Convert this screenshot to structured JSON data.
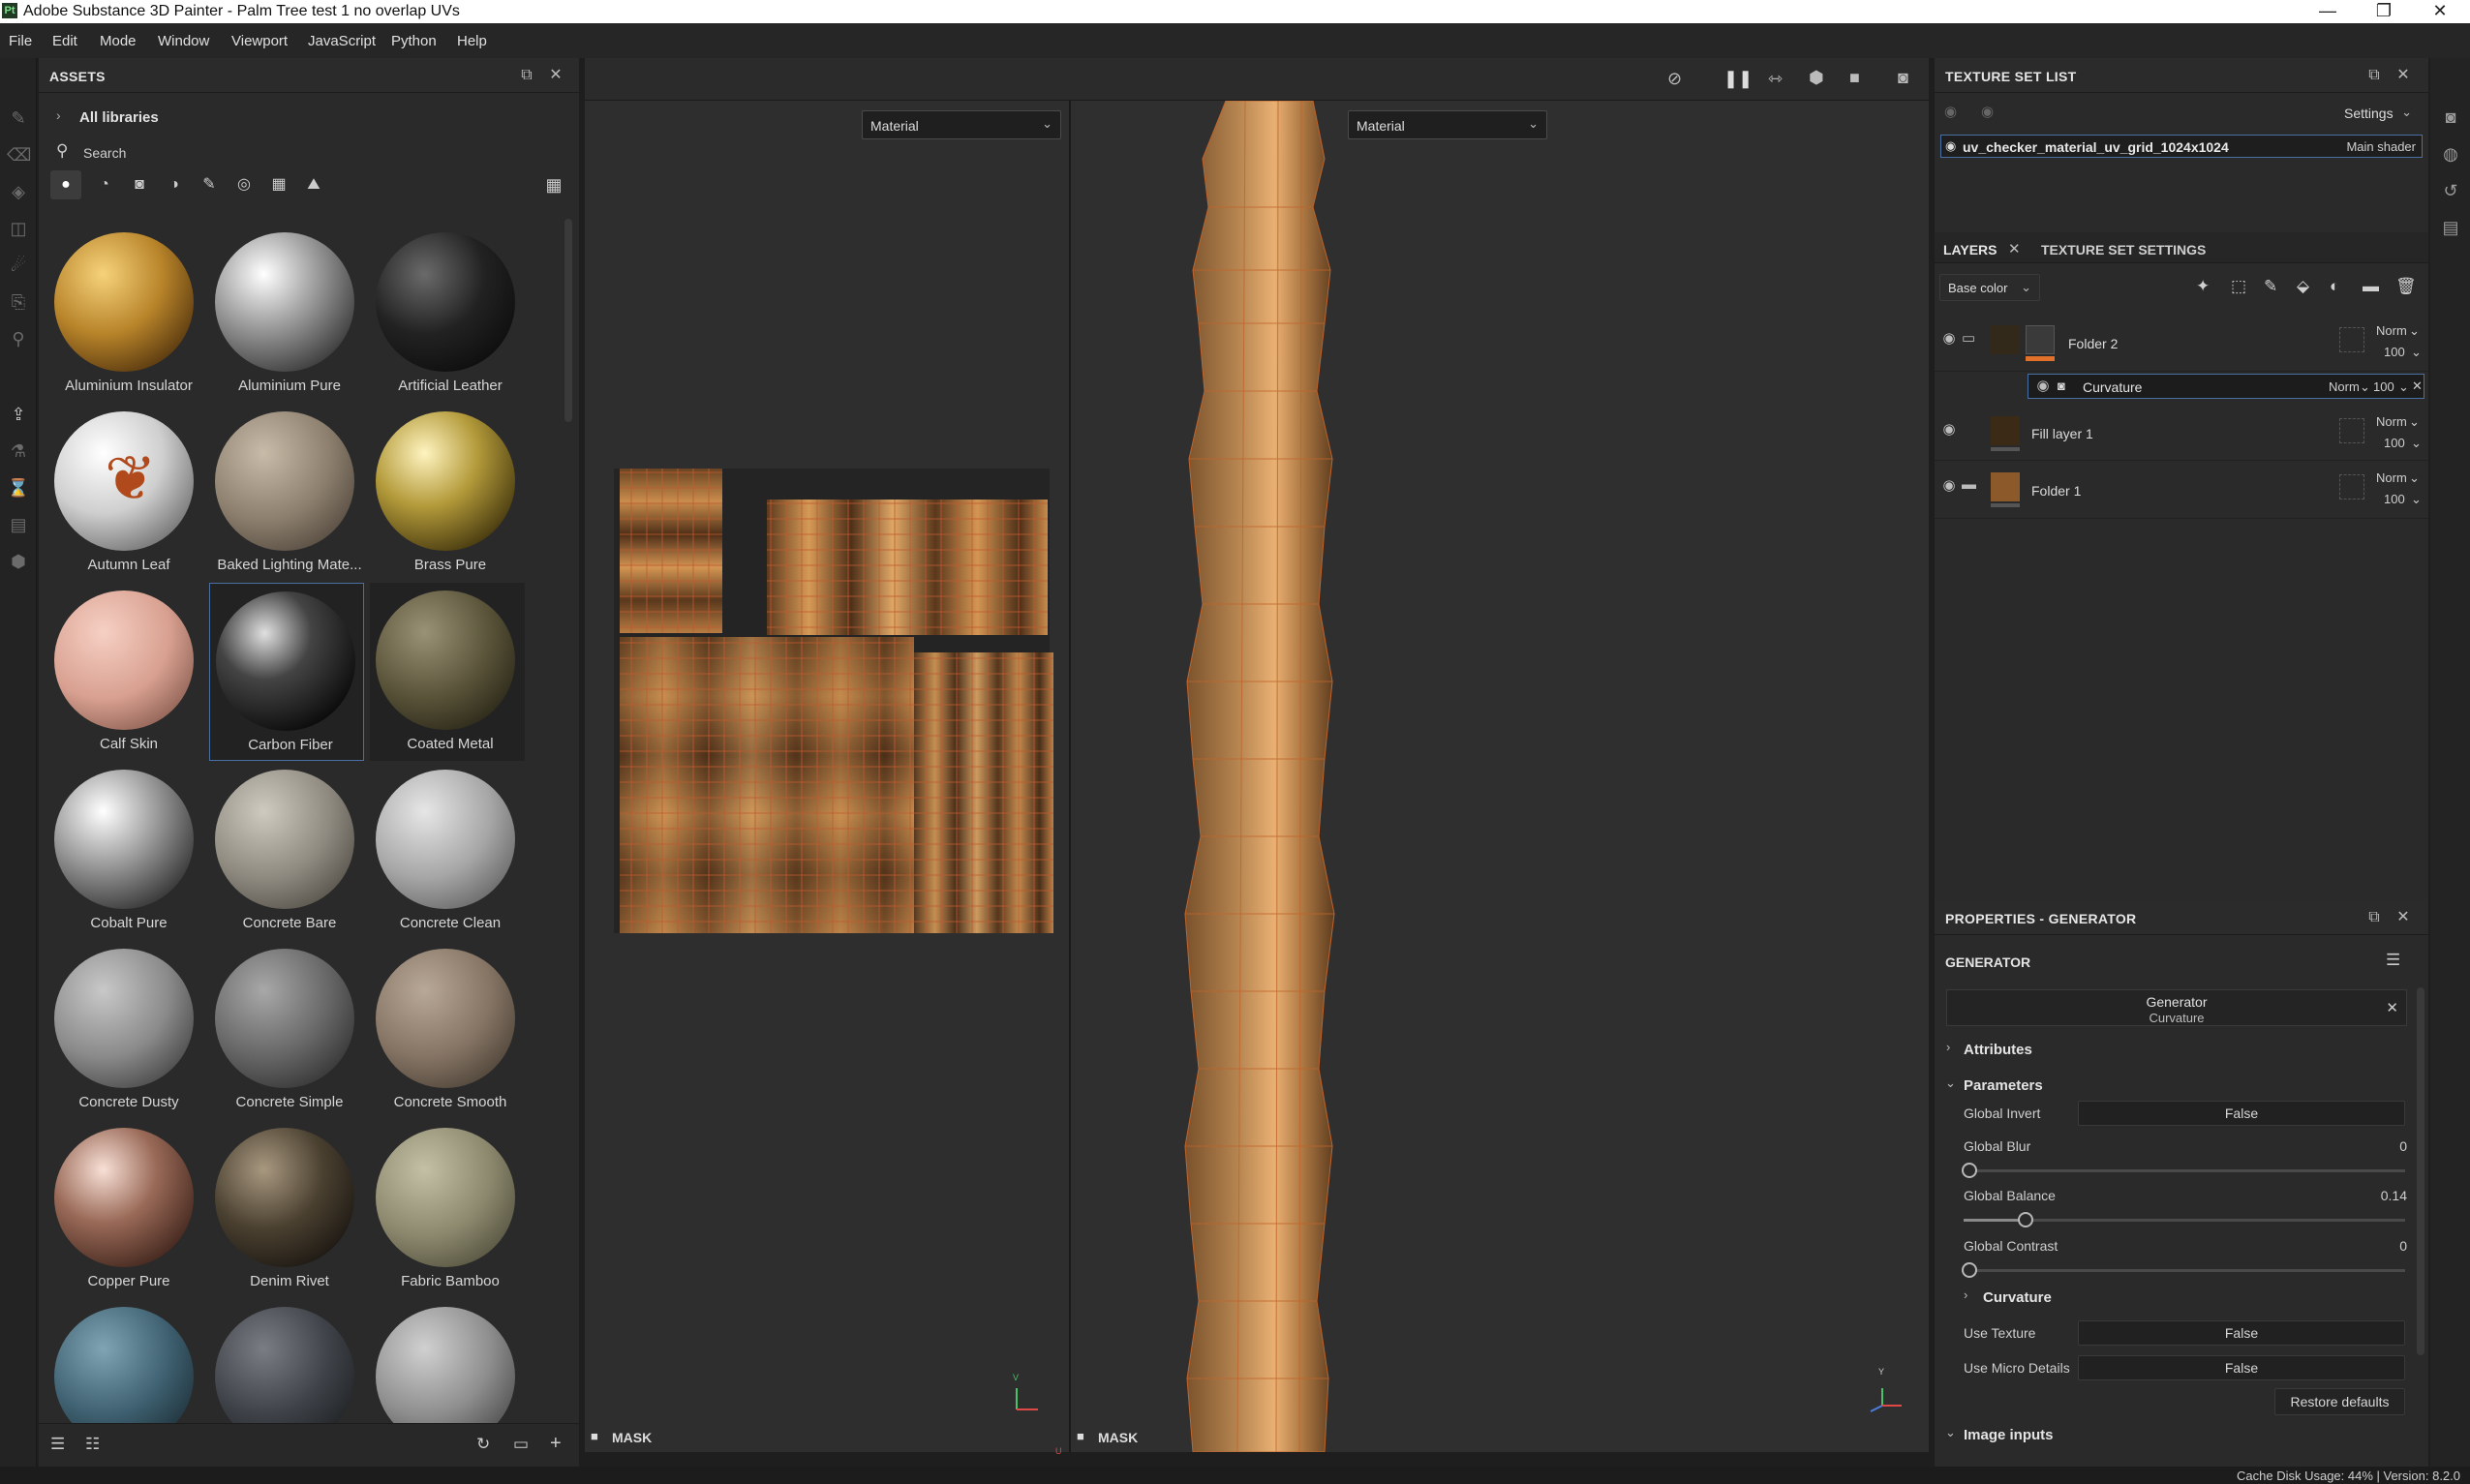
{
  "window": {
    "title": "Adobe Substance 3D Painter - Palm Tree test 1 no overlap UVs",
    "app_icon": "Pt",
    "minimize": "—",
    "maximize": "❐",
    "close": "✕"
  },
  "menu": [
    "File",
    "Edit",
    "Mode",
    "Window",
    "Viewport",
    "JavaScript",
    "Python",
    "Help"
  ],
  "assets": {
    "title": "ASSETS",
    "breadcrumb": "All libraries",
    "search_placeholder": "Search",
    "items": [
      {
        "label": "Aluminium Insulator"
      },
      {
        "label": "Aluminium Pure"
      },
      {
        "label": "Artificial Leather"
      },
      {
        "label": "Autumn Leaf"
      },
      {
        "label": "Baked Lighting Mate..."
      },
      {
        "label": "Brass Pure"
      },
      {
        "label": "Calf Skin"
      },
      {
        "label": "Carbon Fiber"
      },
      {
        "label": "Coated Metal"
      },
      {
        "label": "Cobalt Pure"
      },
      {
        "label": "Concrete Bare"
      },
      {
        "label": "Concrete Clean"
      },
      {
        "label": "Concrete Dusty"
      },
      {
        "label": "Concrete Simple"
      },
      {
        "label": "Concrete Smooth"
      },
      {
        "label": "Copper Pure"
      },
      {
        "label": "Denim Rivet"
      },
      {
        "label": "Fabric Bamboo"
      },
      {
        "label": ""
      },
      {
        "label": ""
      },
      {
        "label": ""
      }
    ],
    "selected_item": "Carbon Fiber"
  },
  "viewport": {
    "uv_mode": "Material",
    "view3d_mode": "Material",
    "uv_mask_label": "MASK",
    "view3d_mask_label": "MASK",
    "uv_axis_v": "V",
    "uv_axis_u": "U",
    "view3d_axis_y": "Y"
  },
  "texture_set_list": {
    "title": "TEXTURE SET LIST",
    "settings_label": "Settings",
    "set_name": "uv_checker_material_uv_grid_1024x1024",
    "shader": "Main shader"
  },
  "layers": {
    "tab_label": "LAYERS",
    "tab2_label": "TEXTURE SET SETTINGS",
    "channel": "Base color",
    "rows": [
      {
        "name": "Folder 2",
        "blend": "Norm",
        "opacity": "100"
      },
      {
        "name": "Curvature",
        "blend": "Norm",
        "opacity": "100"
      },
      {
        "name": "Fill layer 1",
        "blend": "Norm",
        "opacity": "100"
      },
      {
        "name": "Folder 1",
        "blend": "Norm",
        "opacity": "100"
      }
    ]
  },
  "properties": {
    "title": "PROPERTIES - GENERATOR",
    "section_title": "GENERATOR",
    "generator_name": "Generator",
    "generator_sub": "Curvature",
    "attributes_label": "Attributes",
    "parameters_label": "Parameters",
    "global_invert_label": "Global Invert",
    "global_invert_value": "False",
    "global_blur_label": "Global Blur",
    "global_blur_value": "0",
    "global_balance_label": "Global Balance",
    "global_balance_value": "0.14",
    "global_contrast_label": "Global Contrast",
    "global_contrast_value": "0",
    "curvature_label": "Curvature",
    "use_texture_label": "Use Texture",
    "use_texture_value": "False",
    "use_micro_label": "Use Micro Details",
    "use_micro_value": "False",
    "restore_label": "Restore defaults",
    "image_inputs_label": "Image inputs"
  },
  "status": {
    "cache": "Cache Disk Usage:   44% | Version: 8.2.0"
  },
  "colors": {
    "accent_blue": "#4a6fa5",
    "layer_orange": "#e0702a",
    "trunk_brown": "#9a6a3a"
  }
}
